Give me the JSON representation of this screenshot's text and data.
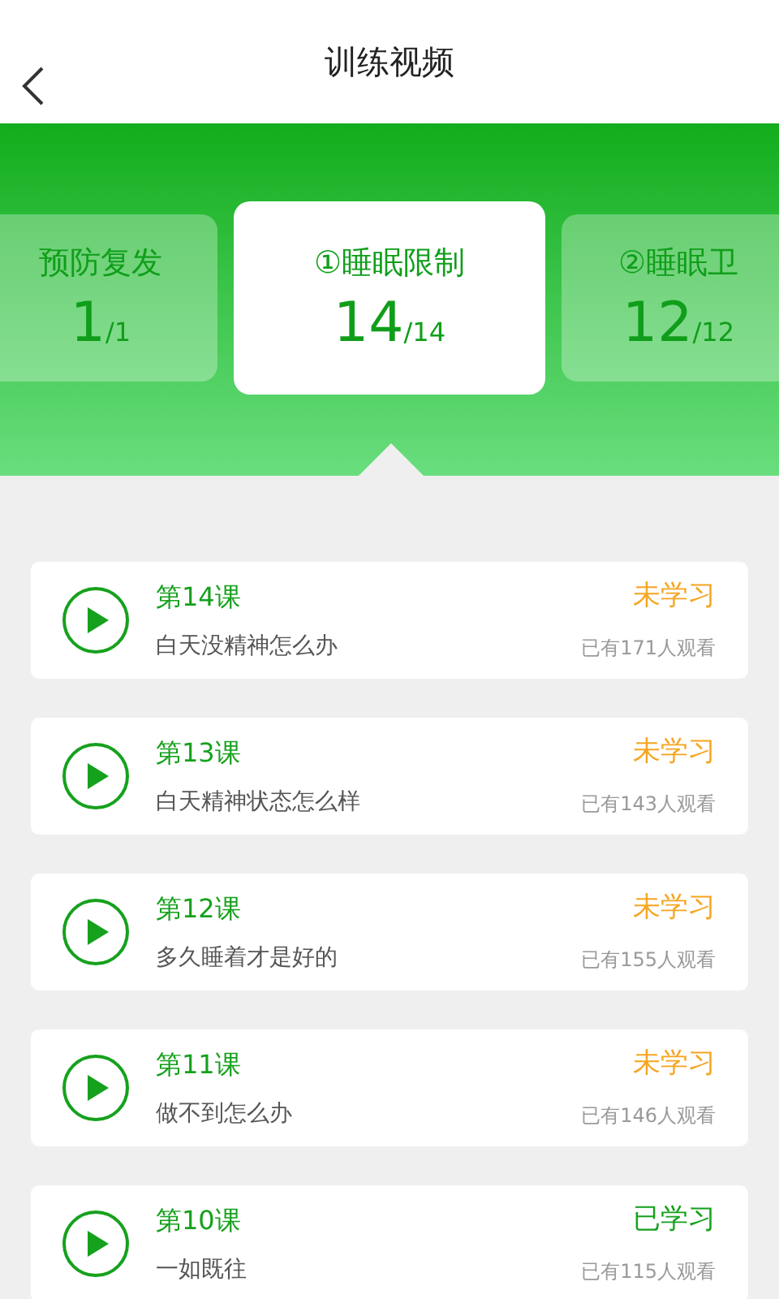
{
  "header": {
    "title": "训练视频"
  },
  "modules": [
    {
      "title": "预防复发",
      "count": "1",
      "total": "/1",
      "selected": false
    },
    {
      "title": "①睡眠限制",
      "count": "14",
      "total": "/14",
      "selected": true
    },
    {
      "title": "②睡眠卫",
      "count": "12",
      "total": "/12",
      "selected": false
    }
  ],
  "lessons": [
    {
      "label": "第14课",
      "status": "未学习",
      "learned": false,
      "title": "白天没精神怎么办",
      "views": "已有171人观看"
    },
    {
      "label": "第13课",
      "status": "未学习",
      "learned": false,
      "title": "白天精神状态怎么样",
      "views": "已有143人观看"
    },
    {
      "label": "第12课",
      "status": "未学习",
      "learned": false,
      "title": "多久睡着才是好的",
      "views": "已有155人观看"
    },
    {
      "label": "第11课",
      "status": "未学习",
      "learned": false,
      "title": "做不到怎么办",
      "views": "已有146人观看"
    },
    {
      "label": "第10课",
      "status": "已学习",
      "learned": true,
      "title": "一如既往",
      "views": "已有115人观看"
    }
  ]
}
